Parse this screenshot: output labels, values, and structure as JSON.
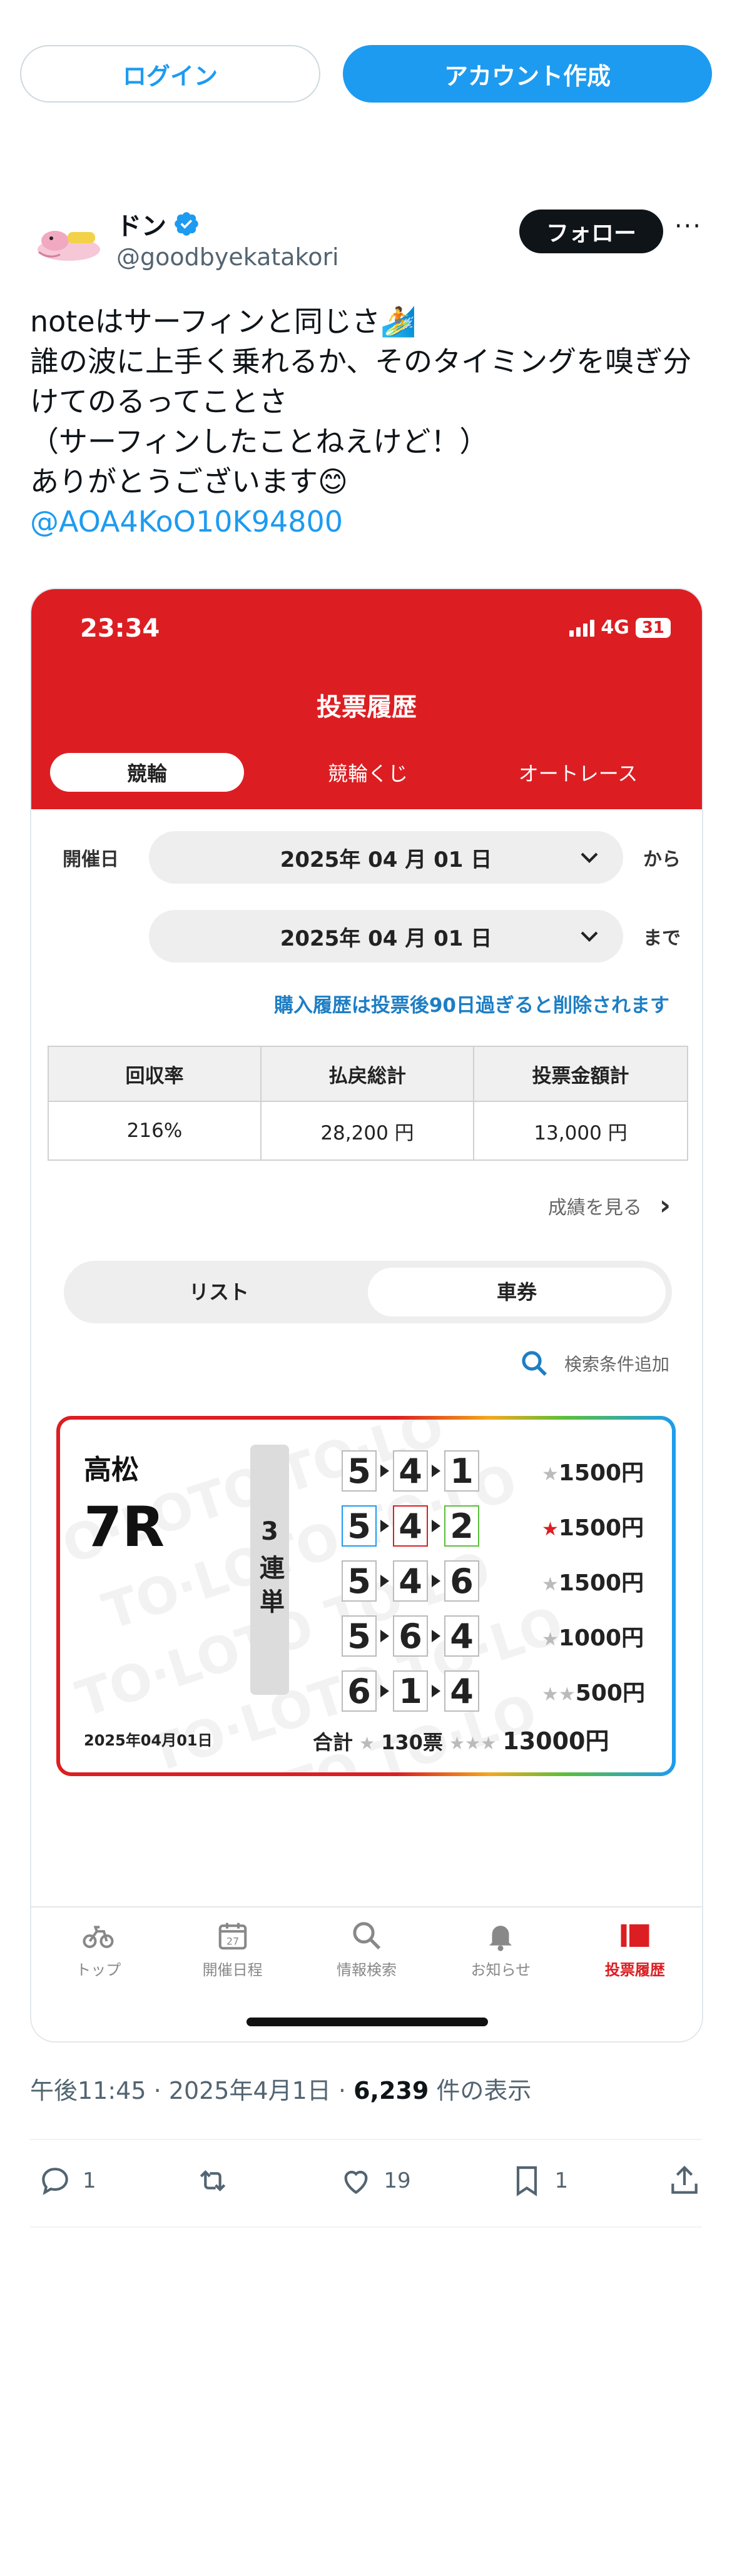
{
  "top_buttons": {
    "login": "ログイン",
    "signup": "アカウント作成"
  },
  "author": {
    "display_name": "ドン",
    "handle": "@goodbyekatakori",
    "follow": "フォロー",
    "more": "···"
  },
  "tweet": {
    "lines": [
      "noteはサーフィンと同じさ🏄",
      "誰の波に上手く乗れるか、そのタイミングを嗅ぎ分けてのるってことさ",
      "（サーフィンしたことねえけど！）",
      "ありがとうございます😊"
    ],
    "mention": "@AOA4KoO10K94800"
  },
  "phone": {
    "time": "23:34",
    "network": "4G",
    "battery": "31",
    "title": "投票履歴",
    "tabs": [
      "競輪",
      "競輪くじ",
      "オートレース"
    ],
    "from_label": "開催日",
    "from_date": "2025年 04 月 01 日",
    "from_suffix": "から",
    "to_date": "2025年 04 月 01 日",
    "to_suffix": "まで",
    "notice": "購入履歴は投票後90日過ぎると削除されます",
    "stats_headers": [
      "回収率",
      "払戻総計",
      "投票金額計"
    ],
    "stats_values": [
      "216%",
      "28,200 円",
      "13,000 円"
    ],
    "see_results": "成績を見る",
    "toggle": [
      "リスト",
      "車券"
    ],
    "search_add": "検索条件追加",
    "ticket": {
      "venue": "高松",
      "race": "7R",
      "bet_type": "3連単",
      "combos": [
        {
          "n": [
            "5",
            "4",
            "1"
          ],
          "stars": "★",
          "amount": "1500円"
        },
        {
          "n": [
            "5",
            "4",
            "2"
          ],
          "stars": "★",
          "amount": "1500円"
        },
        {
          "n": [
            "5",
            "4",
            "6"
          ],
          "stars": "★",
          "amount": "1500円"
        },
        {
          "n": [
            "5",
            "6",
            "4"
          ],
          "stars": "★",
          "amount": "1000円"
        },
        {
          "n": [
            "6",
            "1",
            "4"
          ],
          "stars": "★★",
          "amount": "500円"
        }
      ],
      "date": "2025年04月01日",
      "total_label": "合計",
      "total_count": "130票",
      "total_amount": "13000円",
      "total_stars_a": "★",
      "total_stars_b": "★★★"
    },
    "nav": [
      "トップ",
      "開催日程",
      "情報検索",
      "お知らせ",
      "投票履歴"
    ]
  },
  "meta": {
    "time": "午後11:45",
    "sep": " · ",
    "date": "2025年4月1日",
    "views": "6,239",
    "views_label": " 件の表示"
  },
  "actions": {
    "replies": "1",
    "reposts": "",
    "likes": "19",
    "bookmarks": "1"
  },
  "colors": {
    "brand_red": "#dc1e22",
    "twitter_blue": "#1d9bf0"
  }
}
